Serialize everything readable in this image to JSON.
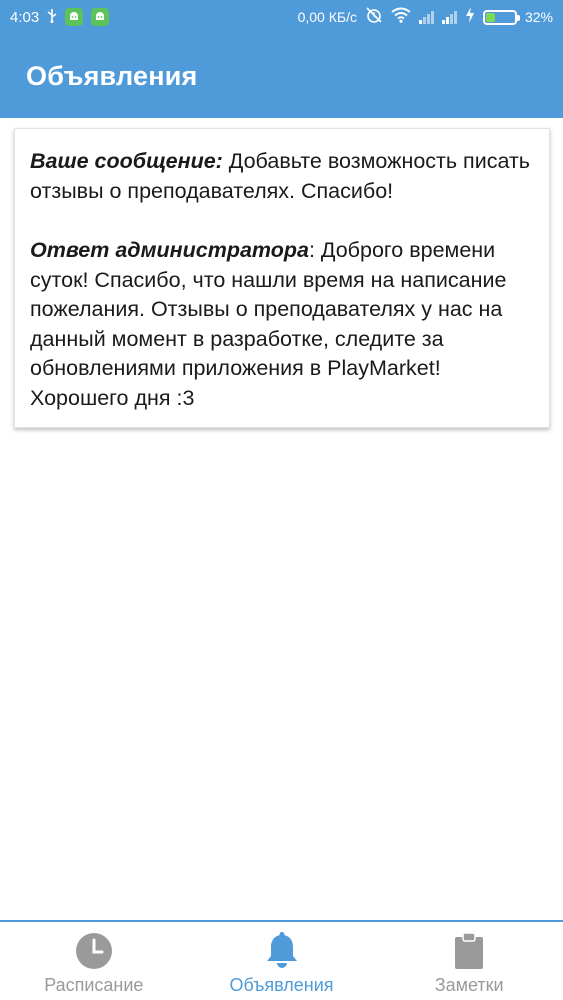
{
  "status_bar": {
    "time": "4:03",
    "net_speed": "0,00 КБ/с",
    "battery_percent": "32%",
    "battery_level": 0.32,
    "icons": [
      "usb-icon",
      "android-icon",
      "android-icon",
      "alarm-off-icon",
      "wifi-icon",
      "signal-icon",
      "signal-icon",
      "charging-icon",
      "battery-icon"
    ]
  },
  "app_bar": {
    "title": "Объявления",
    "color": "#4f9ad8"
  },
  "message": {
    "user_label": "Ваше сообщение:",
    "user_text": " Добавьте возможность писать отзывы о преподавателях. Спасибо!",
    "admin_label": "Ответ администратора",
    "admin_text": ": Доброго времени суток! Спасибо, что нашли время на написание пожелания. Отзывы о преподавателях у нас на данный момент в разработке, следите за обновлениями приложения в PlayMarket! Хорошего дня :3"
  },
  "bottom_nav": {
    "items": [
      {
        "label": "Расписание",
        "icon": "clock-icon",
        "active": false
      },
      {
        "label": "Объявления",
        "icon": "bell-icon",
        "active": true
      },
      {
        "label": "Заметки",
        "icon": "clipboard-icon",
        "active": false
      }
    ],
    "active_color": "#4f9ad8",
    "inactive_color": "#9a9a9a"
  }
}
